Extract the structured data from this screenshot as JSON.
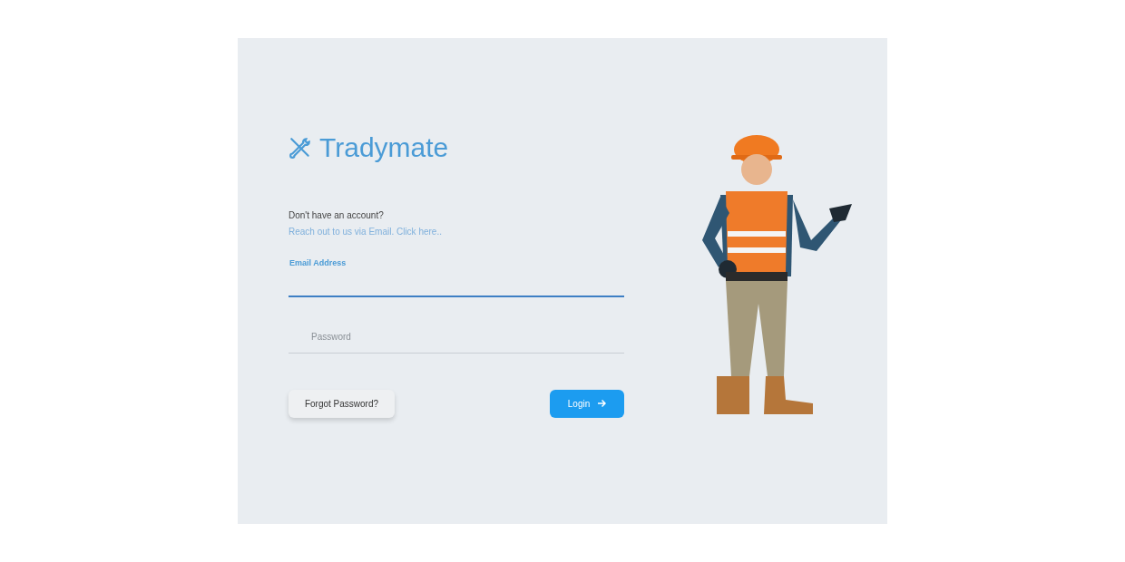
{
  "brand": {
    "name": "Tradymate"
  },
  "signup_prompt": {
    "question": "Don't have an account?",
    "link": "Reach out to us via Email. Click here.."
  },
  "email_field": {
    "label": "Email Address",
    "focused": true
  },
  "password_field": {
    "placeholder": "Password",
    "focused": false
  },
  "buttons": {
    "forgot": "Forgot Password?",
    "login": "Login"
  }
}
